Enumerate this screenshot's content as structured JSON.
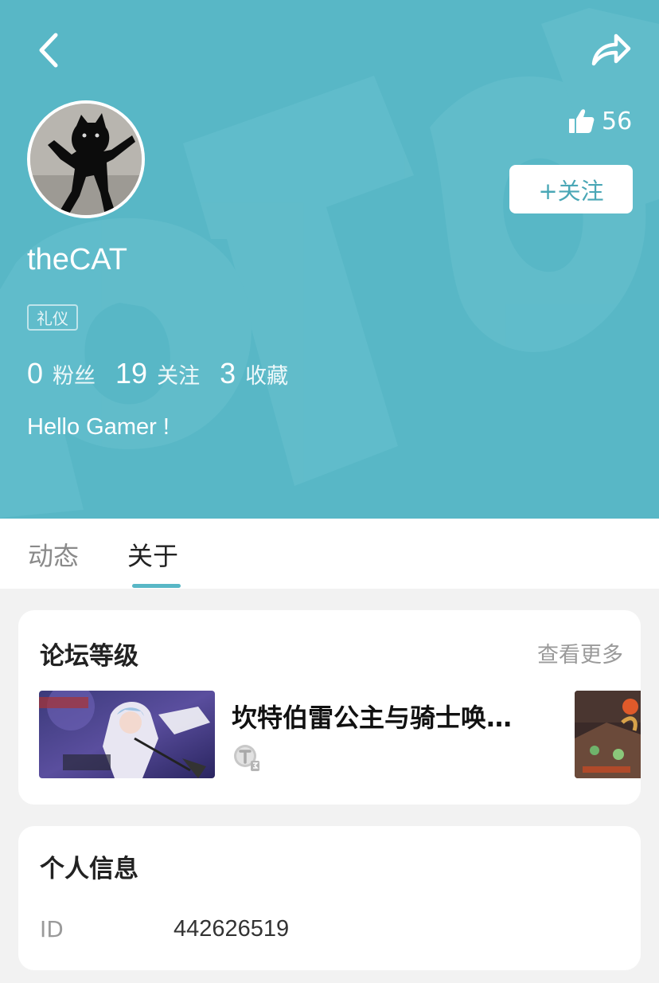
{
  "colors": {
    "accent": "#58b7c6",
    "header_bg": "#58b7c6",
    "page_bg": "#f2f2f2"
  },
  "header": {
    "back_icon": "chevron-left-icon",
    "share_icon": "share-arrow-icon",
    "like_icon": "thumbs-up-icon",
    "likes": "56",
    "follow_label": "+关注"
  },
  "profile": {
    "username": "theCAT",
    "tag": "礼仪",
    "stats": [
      {
        "value": "0",
        "label": "粉丝"
      },
      {
        "value": "19",
        "label": "关注"
      },
      {
        "value": "3",
        "label": "收藏"
      }
    ],
    "bio": "Hello Gamer !"
  },
  "tabs": [
    {
      "label": "动态",
      "active": false
    },
    {
      "label": "关于",
      "active": true
    }
  ],
  "forum_card": {
    "title": "论坛等级",
    "see_more": "查看更多",
    "items": [
      {
        "title": "坎特伯雷公主与骑士唤…",
        "level_icon": "level-badge-icon"
      }
    ]
  },
  "info_card": {
    "title": "个人信息",
    "rows": [
      {
        "label": "ID",
        "value": "442626519"
      }
    ]
  }
}
